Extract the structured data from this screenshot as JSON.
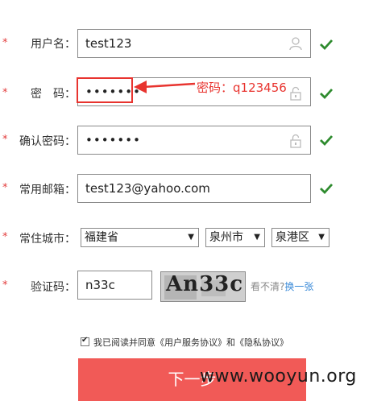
{
  "form": {
    "username": {
      "label": "用户名：",
      "value": "test123"
    },
    "password": {
      "label": "密　码：",
      "value": "•••••••"
    },
    "confirm": {
      "label": "确认密码：",
      "value": "•••••••"
    },
    "email": {
      "label": "常用邮箱：",
      "value": "test123@yahoo.com"
    },
    "city": {
      "label": "常住城市：",
      "province": "福建省",
      "city": "泉州市",
      "district": "泉港区"
    },
    "captcha": {
      "label": "验证码：",
      "value": "n33c",
      "image_text": "An33c",
      "hint": "看不清?",
      "refresh_link": "换一张"
    },
    "required_mark": "*",
    "agreement": {
      "text_before": "我已阅读并同意《",
      "link1": "用户服务协议",
      "mid": "》和《",
      "link2": "隐私协议",
      "text_after": "》"
    },
    "next_button": "下一步"
  },
  "annotation": {
    "text": "密码：q123456"
  },
  "watermark": "www.wooyun.org",
  "colors": {
    "accent_red": "#e8342f",
    "button": "#f15a57",
    "check_green": "#2e8b2e",
    "link": "#3a8ad8"
  }
}
